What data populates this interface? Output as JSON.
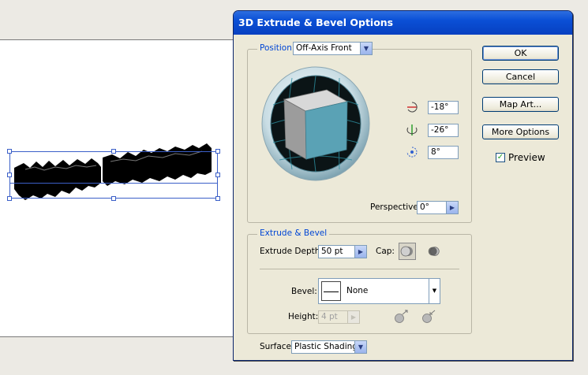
{
  "dialog": {
    "title": "3D Extrude & Bevel Options",
    "position": {
      "legend": "Position:",
      "preset_value": "Off-Axis Front",
      "x_rotation": "-18°",
      "y_rotation": "-26°",
      "z_rotation": "8°",
      "perspective_label": "Perspective:",
      "perspective_value": "0°"
    },
    "extrude": {
      "legend": "Extrude & Bevel",
      "depth_label": "Extrude Depth:",
      "depth_value": "50 pt",
      "cap_label": "Cap:",
      "bevel_label": "Bevel:",
      "bevel_value": "None",
      "height_label": "Height:",
      "height_value": "4 pt"
    },
    "surface": {
      "label": "Surface:",
      "value": "Plastic Shading"
    },
    "buttons": {
      "ok": "OK",
      "cancel": "Cancel",
      "map_art": "Map Art...",
      "more_options": "More Options"
    },
    "preview": {
      "label": "Preview",
      "checked": true
    }
  },
  "colors": {
    "title_bar": "#0a4fd6",
    "legend_text": "#0046d5",
    "cube_front": "#5aa2b5",
    "cube_top": "#d8d8d8",
    "cube_side": "#9c9c9c",
    "selection": "#3b5fc8"
  }
}
